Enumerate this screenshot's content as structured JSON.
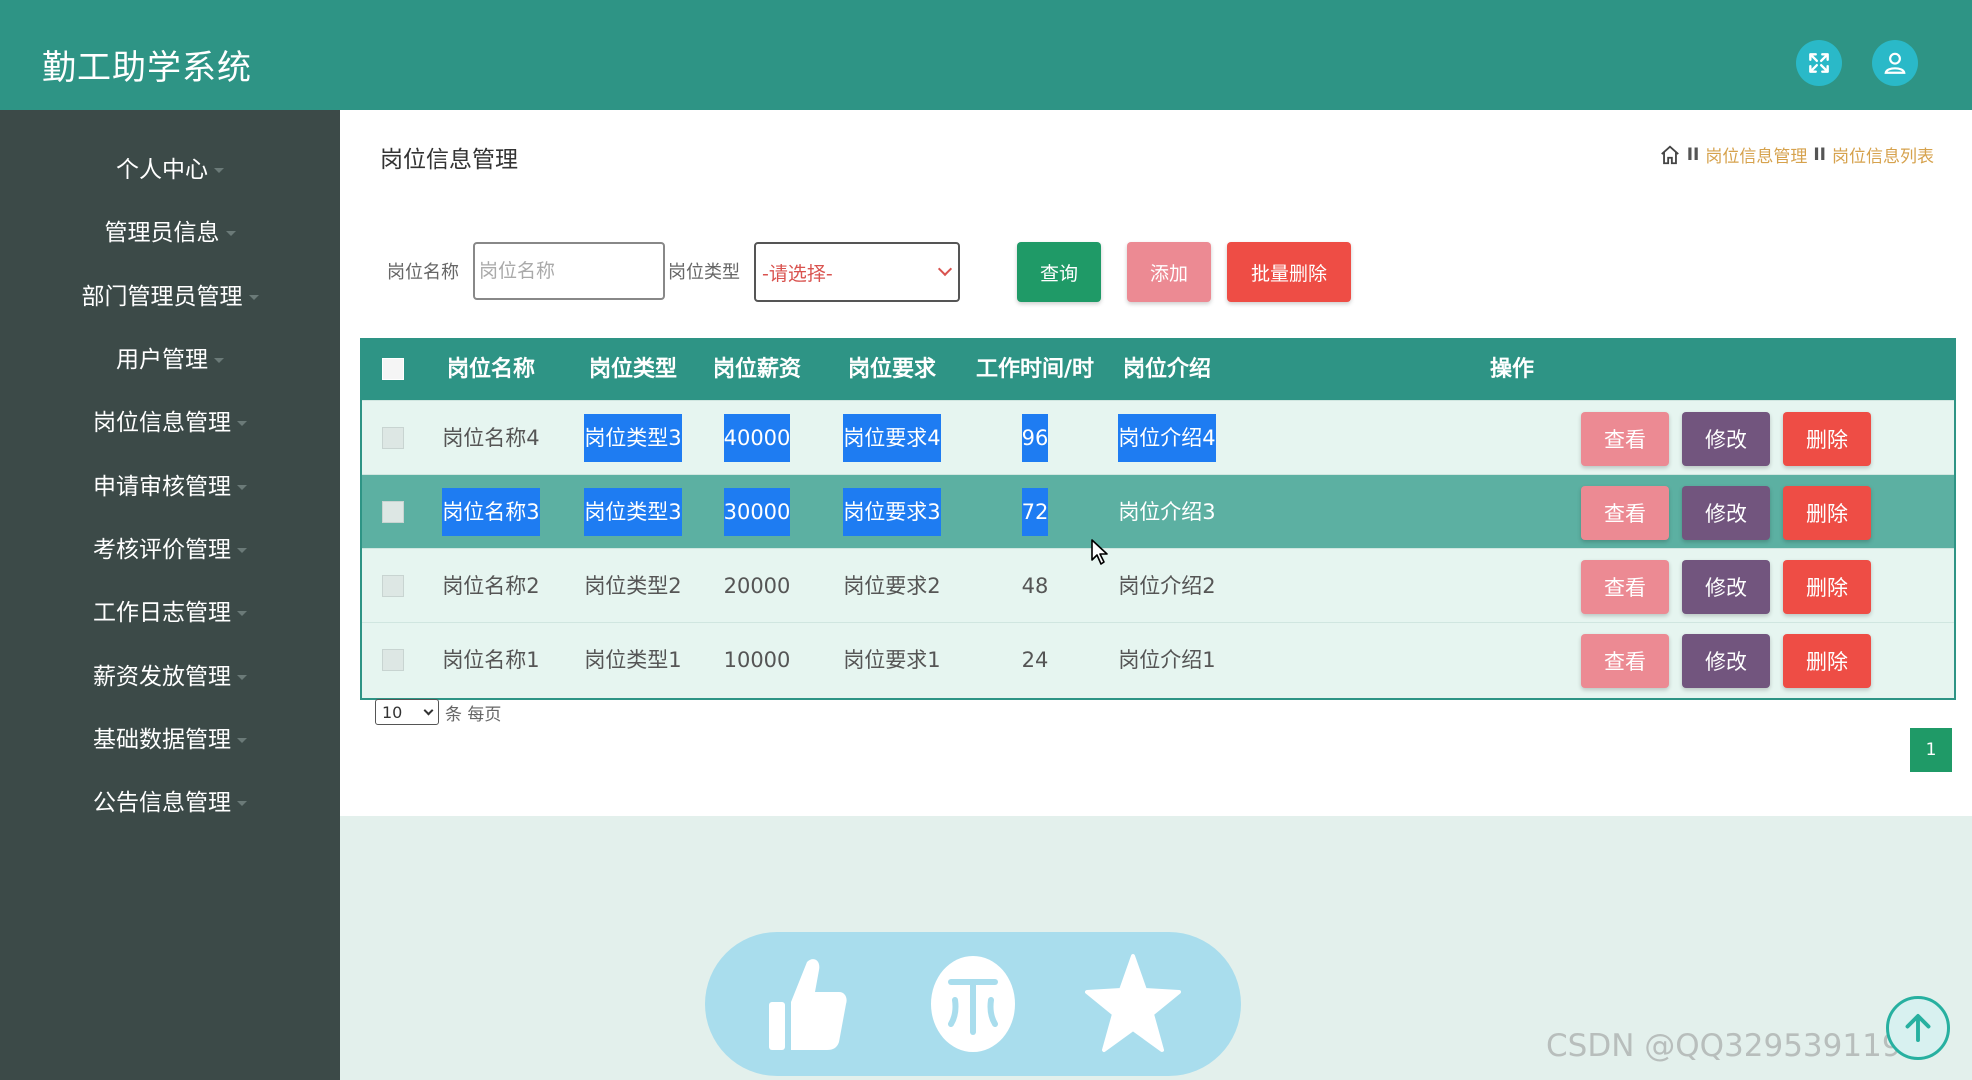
{
  "app": {
    "title": "勤工助学系统"
  },
  "topbar": {
    "icons": [
      "fullscreen-icon",
      "user-icon"
    ]
  },
  "sidebar": {
    "items": [
      {
        "label": "个人中心"
      },
      {
        "label": "管理员信息"
      },
      {
        "label": "部门管理员管理"
      },
      {
        "label": "用户管理"
      },
      {
        "label": "岗位信息管理"
      },
      {
        "label": "申请审核管理"
      },
      {
        "label": "考核评价管理"
      },
      {
        "label": "工作日志管理"
      },
      {
        "label": "薪资发放管理"
      },
      {
        "label": "基础数据管理"
      },
      {
        "label": "公告信息管理"
      }
    ]
  },
  "page": {
    "title": "岗位信息管理",
    "breadcrumb": {
      "level1": "岗位信息管理",
      "level2": "岗位信息列表",
      "separator": "II"
    }
  },
  "search": {
    "name_label": "岗位名称",
    "name_placeholder": "岗位名称",
    "type_label": "岗位类型",
    "type_selected": "-请选择-",
    "query_label": "查询",
    "add_label": "添加",
    "batch_delete_label": "批量删除"
  },
  "table": {
    "headers": [
      "岗位名称",
      "岗位类型",
      "岗位薪资",
      "岗位要求",
      "工作时间/时",
      "岗位介绍",
      "操作"
    ],
    "rows": [
      {
        "name": "岗位名称4",
        "type": "岗位类型3",
        "salary": "40000",
        "requirement": "岗位要求4",
        "hours": "96",
        "intro": "岗位介绍4"
      },
      {
        "name": "岗位名称3",
        "type": "岗位类型3",
        "salary": "30000",
        "requirement": "岗位要求3",
        "hours": "72",
        "intro": "岗位介绍3"
      },
      {
        "name": "岗位名称2",
        "type": "岗位类型2",
        "salary": "20000",
        "requirement": "岗位要求2",
        "hours": "48",
        "intro": "岗位介绍2"
      },
      {
        "name": "岗位名称1",
        "type": "岗位类型1",
        "salary": "10000",
        "requirement": "岗位要求1",
        "hours": "24",
        "intro": "岗位介绍1"
      }
    ],
    "actions": {
      "view": "查看",
      "edit": "修改",
      "delete": "删除"
    }
  },
  "pagination": {
    "page_size": "10",
    "per_page_text": "条 每页",
    "current_page": "1"
  },
  "float_bar": {
    "icons": [
      "thumbs-up-icon",
      "coin-icon",
      "star-icon"
    ]
  },
  "watermark": "CSDN @QQ3295391197",
  "colors": {
    "header": "#2e9485",
    "sidebar": "#3c4a48",
    "query": "#1f9a67",
    "add": "#ec8a93",
    "delete": "#ee4d45",
    "edit": "#72557e",
    "highlight": "#1e7cf2"
  }
}
